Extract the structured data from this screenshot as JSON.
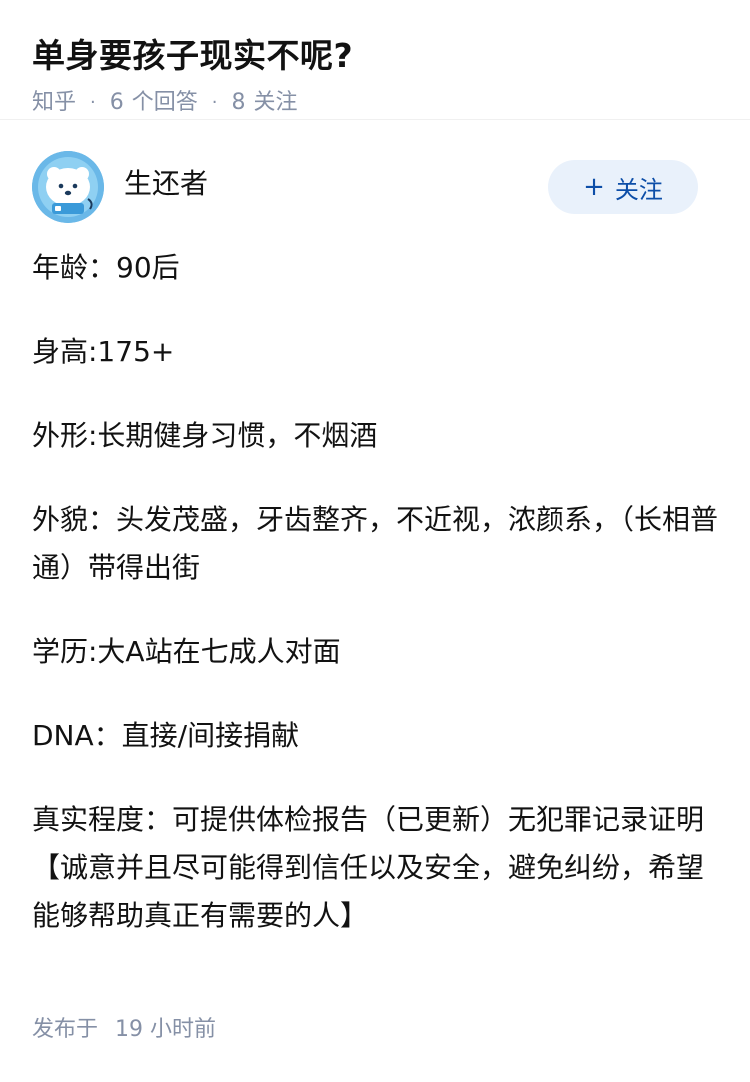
{
  "question": {
    "title": "单身要孩子现实不呢?",
    "source": "知乎",
    "dot": "·",
    "answer_count": "6",
    "answer_label": "个回答",
    "follower_count": "8",
    "follower_label": "关注"
  },
  "author": {
    "avatar_icon": "cartoon-avatar",
    "name": "生还者",
    "follow_button": {
      "icon": "plus-icon",
      "plus": "+",
      "label": "关注"
    }
  },
  "answer": {
    "paragraphs": [
      "年龄：90后",
      "身高:175+",
      "外形:长期健身习惯，不烟酒",
      "外貌：头发茂盛，牙齿整齐，不近视，浓颜系，（长相普通）带得出街",
      "学历:大A站在七成人对面",
      "DNA：直接/间接捐献",
      "真实程度：可提供体检报告（已更新）无犯罪记录证明【诚意并且尽可能得到信任以及安全，避免纠纷，希望能够帮助真正有需要的人】"
    ],
    "publish_label": "发布于",
    "publish_time": "19 小时前"
  },
  "colors": {
    "meta_gray": "#8590a6",
    "follow_bg": "#e9f1fb",
    "follow_text": "#0d4ea8",
    "avatar_blue": "#6ab8e8"
  }
}
